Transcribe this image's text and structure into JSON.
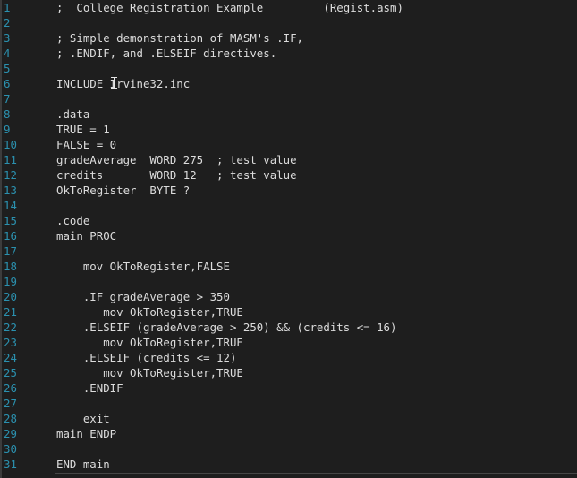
{
  "editor": {
    "lines": [
      {
        "num": "1",
        "text": ";  College Registration Example         (Regist.asm)"
      },
      {
        "num": "2",
        "text": ""
      },
      {
        "num": "3",
        "text": "; Simple demonstration of MASM's .IF,"
      },
      {
        "num": "4",
        "text": "; .ENDIF, and .ELSEIF directives."
      },
      {
        "num": "5",
        "text": ""
      },
      {
        "num": "6",
        "text": "INCLUDE Irvine32.inc"
      },
      {
        "num": "7",
        "text": ""
      },
      {
        "num": "8",
        "text": ".data"
      },
      {
        "num": "9",
        "text": "TRUE = 1"
      },
      {
        "num": "10",
        "text": "FALSE = 0"
      },
      {
        "num": "11",
        "text": "gradeAverage  WORD 275  ; test value"
      },
      {
        "num": "12",
        "text": "credits       WORD 12   ; test value"
      },
      {
        "num": "13",
        "text": "OkToRegister  BYTE ?"
      },
      {
        "num": "14",
        "text": ""
      },
      {
        "num": "15",
        "text": ".code"
      },
      {
        "num": "16",
        "text": "main PROC"
      },
      {
        "num": "17",
        "text": ""
      },
      {
        "num": "18",
        "text": "    mov OkToRegister,FALSE"
      },
      {
        "num": "19",
        "text": ""
      },
      {
        "num": "20",
        "text": "    .IF gradeAverage > 350"
      },
      {
        "num": "21",
        "text": "       mov OkToRegister,TRUE"
      },
      {
        "num": "22",
        "text": "    .ELSEIF (gradeAverage > 250) && (credits <= 16)"
      },
      {
        "num": "23",
        "text": "       mov OkToRegister,TRUE"
      },
      {
        "num": "24",
        "text": "    .ELSEIF (credits <= 12)"
      },
      {
        "num": "25",
        "text": "       mov OkToRegister,TRUE"
      },
      {
        "num": "26",
        "text": "    .ENDIF"
      },
      {
        "num": "27",
        "text": ""
      },
      {
        "num": "28",
        "text": "    exit"
      },
      {
        "num": "29",
        "text": "main ENDP"
      },
      {
        "num": "30",
        "text": ""
      },
      {
        "num": "31",
        "text": "END main"
      }
    ],
    "current_line": "31"
  },
  "colors": {
    "background": "#1e1e1e",
    "line_number": "#2b91af",
    "text": "#dcdcdc",
    "current_line_border": "#464646"
  },
  "icons": {
    "cursor": "text-cursor-icon"
  }
}
